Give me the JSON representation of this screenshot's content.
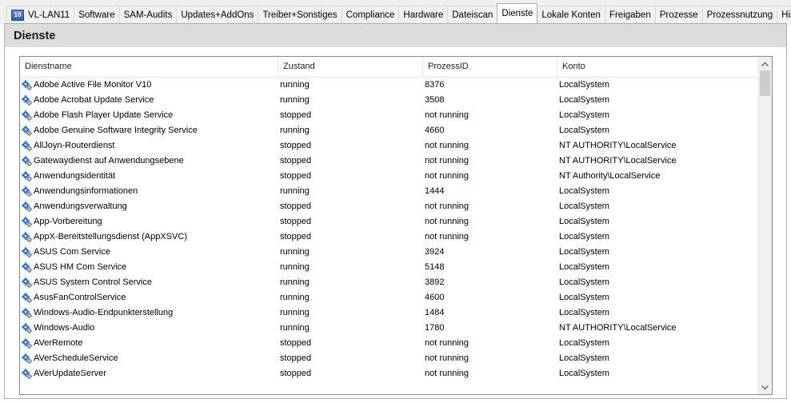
{
  "tabs": [
    {
      "label": "VL-LAN11",
      "icon": "computer-icon",
      "active": false
    },
    {
      "label": "Software",
      "active": false
    },
    {
      "label": "SAM-Audits",
      "active": false
    },
    {
      "label": "Updates+AddOns",
      "active": false
    },
    {
      "label": "Treiber+Sonstiges",
      "active": false
    },
    {
      "label": "Compliance",
      "active": false
    },
    {
      "label": "Hardware",
      "active": false
    },
    {
      "label": "Dateiscan",
      "active": false
    },
    {
      "label": "Dienste",
      "active": true
    },
    {
      "label": "Lokale Konten",
      "active": false
    },
    {
      "label": "Freigaben",
      "active": false
    },
    {
      "label": "Prozesse",
      "active": false
    },
    {
      "label": "Prozessnutzung",
      "active": false
    },
    {
      "label": "Historie",
      "active": false
    }
  ],
  "section": {
    "title": "Dienste"
  },
  "columns": [
    "Dienstname",
    "Zustand",
    "ProzessID",
    "Konto"
  ],
  "rows": [
    {
      "name": "Adobe Active File Monitor V10",
      "state": "running",
      "pid": "8376",
      "account": "LocalSystem"
    },
    {
      "name": "Adobe Acrobat Update Service",
      "state": "running",
      "pid": "3508",
      "account": "LocalSystem"
    },
    {
      "name": "Adobe Flash Player Update Service",
      "state": "stopped",
      "pid": "not running",
      "account": "LocalSystem"
    },
    {
      "name": "Adobe Genuine Software Integrity Service",
      "state": "running",
      "pid": "4660",
      "account": "LocalSystem"
    },
    {
      "name": "AllJoyn-Routerdienst",
      "state": "stopped",
      "pid": "not running",
      "account": "NT AUTHORITY\\LocalService"
    },
    {
      "name": "Gatewaydienst auf Anwendungsebene",
      "state": "stopped",
      "pid": "not running",
      "account": "NT AUTHORITY\\LocalService"
    },
    {
      "name": "Anwendungsidentität",
      "state": "stopped",
      "pid": "not running",
      "account": "NT Authority\\LocalService"
    },
    {
      "name": "Anwendungsinformationen",
      "state": "running",
      "pid": "1444",
      "account": "LocalSystem"
    },
    {
      "name": "Anwendungsverwaltung",
      "state": "stopped",
      "pid": "not running",
      "account": "LocalSystem"
    },
    {
      "name": "App-Vorbereitung",
      "state": "stopped",
      "pid": "not running",
      "account": "LocalSystem"
    },
    {
      "name": "AppX-Bereitstellungsdienst (AppXSVC)",
      "state": "stopped",
      "pid": "not running",
      "account": "LocalSystem"
    },
    {
      "name": "ASUS Com Service",
      "state": "running",
      "pid": "3924",
      "account": "LocalSystem"
    },
    {
      "name": "ASUS HM Com Service",
      "state": "running",
      "pid": "5148",
      "account": "LocalSystem"
    },
    {
      "name": "ASUS System Control Service",
      "state": "running",
      "pid": "3892",
      "account": "LocalSystem"
    },
    {
      "name": "AsusFanControlService",
      "state": "running",
      "pid": "4600",
      "account": "LocalSystem"
    },
    {
      "name": "Windows-Audio-Endpunkterstellung",
      "state": "running",
      "pid": "1484",
      "account": "LocalSystem"
    },
    {
      "name": "Windows-Audio",
      "state": "running",
      "pid": "1780",
      "account": "NT AUTHORITY\\LocalService"
    },
    {
      "name": "AVerRemote",
      "state": "stopped",
      "pid": "not running",
      "account": "LocalSystem"
    },
    {
      "name": "AVerScheduleService",
      "state": "stopped",
      "pid": "not running",
      "account": "LocalSystem"
    },
    {
      "name": "AVerUpdateServer",
      "state": "stopped",
      "pid": "not running",
      "account": "LocalSystem"
    }
  ],
  "colors": {
    "tab_bg": "#f0f0f0",
    "header_band": "#dcdcdc",
    "list_border": "#828790",
    "service_icon_blue": "#2f6fc8",
    "service_icon_gear": "#8a8f96"
  },
  "row_icon": "service-gear-icon"
}
